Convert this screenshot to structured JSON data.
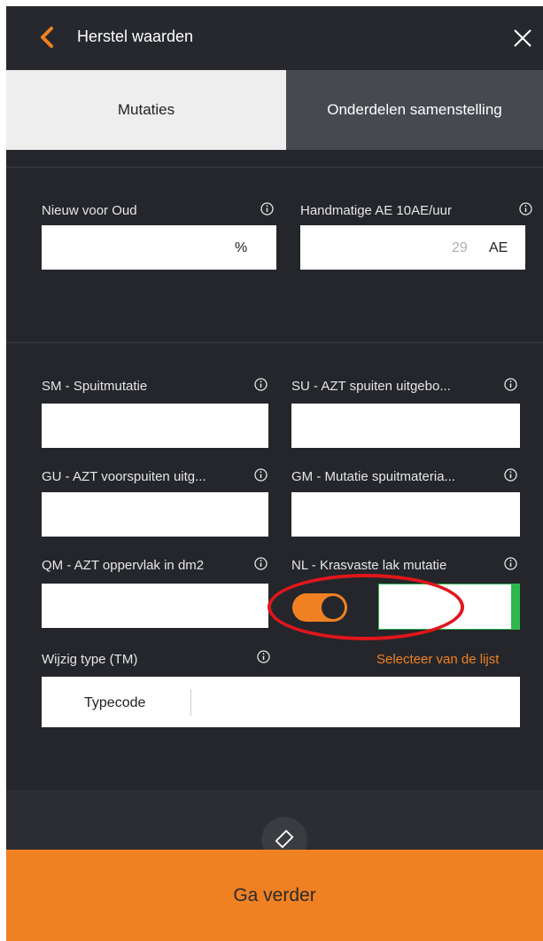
{
  "header": {
    "title": "Herstel waarden",
    "back_icon": "chevron-left-icon",
    "close_icon": "close-icon"
  },
  "tabs": [
    {
      "label": "Mutaties",
      "active": true
    },
    {
      "label": "Onderdelen samenstelling",
      "active": false
    }
  ],
  "section1": {
    "nieuw_voor_oud": {
      "label": "Nieuw voor Oud",
      "value": "",
      "unit": "%"
    },
    "handmatige_ae": {
      "label": "Handmatige AE 10AE/uur",
      "value": "29",
      "unit": "AE"
    }
  },
  "section2": {
    "sm": {
      "label": "SM - Spuitmutatie",
      "value": ""
    },
    "su": {
      "label": "SU - AZT spuiten uitgebo...",
      "value": ""
    },
    "gu": {
      "label": "GU - AZT voorspuiten uitg...",
      "value": ""
    },
    "gm": {
      "label": "GM - Mutatie spuitmateria...",
      "value": ""
    },
    "qm": {
      "label": "QM - AZT oppervlak in dm2",
      "value": ""
    },
    "nl": {
      "label": "NL - Krasvaste lak mutatie",
      "toggle_on": true,
      "value": ""
    },
    "type": {
      "label": "Wijzig type (TM)",
      "link": "Selecteer van de lijst",
      "typecode_label": "Typecode",
      "value": ""
    }
  },
  "footer": {
    "cta_label": "Ga verder",
    "eraser_icon": "eraser-icon"
  },
  "colors": {
    "accent": "#f08122",
    "background": "#24262b",
    "highlight": "#e0161b",
    "valid": "#2db84d"
  }
}
